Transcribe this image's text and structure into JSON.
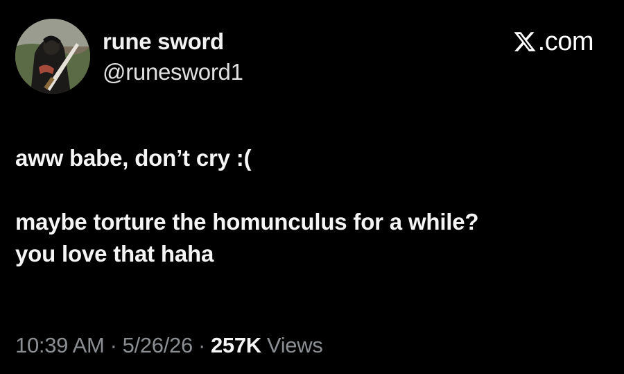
{
  "author": {
    "display_name": "rune sword",
    "handle": "@runesword1"
  },
  "brand": {
    "text": ".com",
    "icon": "x-logo-icon"
  },
  "post": {
    "lines": [
      "aww babe, don’t cry :(",
      "",
      "maybe torture the homunculus for a while?",
      "you love that haha"
    ]
  },
  "meta": {
    "time": "10:39 AM",
    "separator": "·",
    "date": "5/26/26",
    "views_count": "257K",
    "views_label": "Views"
  },
  "colors": {
    "background": "#000000",
    "text": "#f5f5f5",
    "muted": "#8b8f93"
  }
}
